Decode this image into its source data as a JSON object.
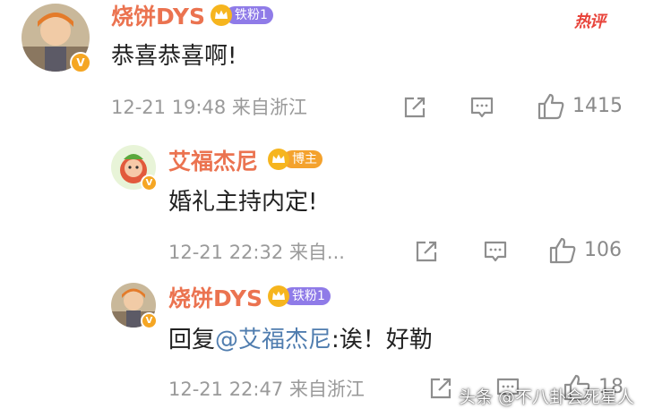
{
  "hot_tag": "热评",
  "comments": [
    {
      "username": "烧饼DYS",
      "badge": "铁粉1",
      "content": "恭喜恭喜啊!",
      "meta": "12-21 19:48 来自浙江",
      "likes": "1415"
    },
    {
      "username": "艾福杰尼",
      "badge": "博主",
      "content": "婚礼主持内定!",
      "meta": "12-21 22:32 来自...",
      "likes": "106"
    },
    {
      "username": "烧饼DYS",
      "badge": "铁粉1",
      "content_prefix": "回复",
      "mention": "@艾福杰尼",
      "content_suffix": ":诶！好勒",
      "meta": "12-21 22:47 来自浙江",
      "likes": "18"
    }
  ],
  "watermark": "头条 @不八卦会死星人",
  "colors": {
    "username": "#eb7350",
    "mention": "#507daf",
    "fan_badge": "#8f7be8",
    "host_badge": "#f4a22d",
    "verified": "#f5a623"
  }
}
